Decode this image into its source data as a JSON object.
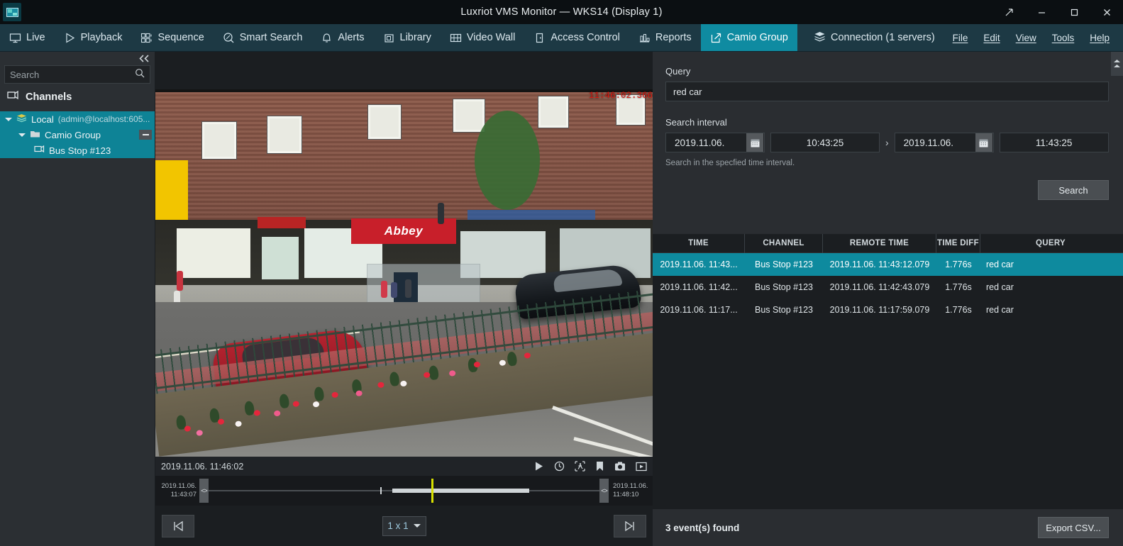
{
  "window": {
    "title": "Luxriot VMS Monitor — WKS14 (Display 1)",
    "app_icon": "monitor-icon",
    "restore_label": "⤢",
    "minimize_label": "–",
    "maximize_label": "▢",
    "close_label": "✕"
  },
  "tabs": [
    {
      "label": "Live",
      "icon": "monitor-icon",
      "active": false
    },
    {
      "label": "Playback",
      "icon": "play-triangle-icon",
      "active": false
    },
    {
      "label": "Sequence",
      "icon": "grid-sequence-icon",
      "active": false
    },
    {
      "label": "Smart Search",
      "icon": "magnifier-motion-icon",
      "active": false
    },
    {
      "label": "Alerts",
      "icon": "bell-icon",
      "active": false
    },
    {
      "label": "Library",
      "icon": "folder-archive-icon",
      "active": false
    },
    {
      "label": "Video Wall",
      "icon": "table-grid-icon",
      "active": false
    },
    {
      "label": "Access Control",
      "icon": "door-icon",
      "active": false
    },
    {
      "label": "Reports",
      "icon": "bar-chart-icon",
      "active": false
    },
    {
      "label": "Camio Group",
      "icon": "external-link-icon",
      "active": true
    }
  ],
  "connection": {
    "label": "Connection (1 servers)",
    "icon": "servers-stack-icon"
  },
  "menus": [
    {
      "label": "File"
    },
    {
      "label": "Edit"
    },
    {
      "label": "View"
    },
    {
      "label": "Tools"
    },
    {
      "label": "Help"
    }
  ],
  "sidebar": {
    "collapse_icon": "double-chevron-left-icon",
    "search": {
      "placeholder": "Search",
      "value": "",
      "icon": "search-icon"
    },
    "header": {
      "label": "Channels",
      "icon": "channels-icon"
    },
    "tree": [
      {
        "label": "Local",
        "sub": "(admin@localhost:605...",
        "level": 0,
        "selected": true,
        "expanded": true,
        "icon": "server-stack-icon"
      },
      {
        "label": "Camio Group",
        "sub": "",
        "level": 1,
        "selected": true,
        "expanded": true,
        "icon": "folder-icon",
        "has_minus": true
      },
      {
        "label": "Bus Stop #123",
        "sub": "",
        "level": 2,
        "selected": true,
        "expanded": false,
        "icon": "camera-channel-icon"
      }
    ]
  },
  "player": {
    "overlay_timestamp": "11:46:02.366",
    "current_time": "2019.11.06. 11:46:02",
    "toolbar_icons": [
      {
        "name": "play-icon"
      },
      {
        "name": "clock-icon"
      },
      {
        "name": "motion-search-icon"
      },
      {
        "name": "bookmark-icon"
      },
      {
        "name": "snapshot-camera-icon"
      },
      {
        "name": "export-video-icon"
      }
    ],
    "timeline": {
      "start_date": "2019.11.06.",
      "start_time": "11:43:07",
      "end_date": "2019.11.06.",
      "end_time": "11:48:10",
      "cursor_percent": 57,
      "recorded_start_percent": 47,
      "recorded_end_percent": 82,
      "tick_percent": 44
    },
    "prev_label": "◀|",
    "next_label": "|▶",
    "layout": {
      "value": "1 x 1"
    }
  },
  "search_panel": {
    "query_label": "Query",
    "query_value": "red car",
    "query_placeholder": "Query",
    "interval_label": "Search interval",
    "from_date": "2019.11.06.",
    "from_time": "10:43:25",
    "to_date": "2019.11.06.",
    "to_time": "11:43:25",
    "separator": "›",
    "calendar_icon": "calendar-icon",
    "hint": "Search in the specfied time interval.",
    "search_button": "Search"
  },
  "results": {
    "columns": [
      "TIME",
      "CHANNEL",
      "REMOTE TIME",
      "TIME DIFF",
      "QUERY"
    ],
    "rows": [
      {
        "time": "2019.11.06. 11:43...",
        "channel": "Bus Stop #123",
        "remote_time": "2019.11.06. 11:43:12.079",
        "time_diff": "1.776s",
        "query": "red car",
        "selected": true
      },
      {
        "time": "2019.11.06. 11:42...",
        "channel": "Bus Stop #123",
        "remote_time": "2019.11.06. 11:42:43.079",
        "time_diff": "1.776s",
        "query": "red car",
        "selected": false
      },
      {
        "time": "2019.11.06. 11:17...",
        "channel": "Bus Stop #123",
        "remote_time": "2019.11.06. 11:17:59.079",
        "time_diff": "1.776s",
        "query": "red car",
        "selected": false
      }
    ]
  },
  "status": {
    "found_text": "3 event(s) found",
    "export_button": "Export CSV..."
  },
  "colors": {
    "accent_teal": "#0f8ba1",
    "tabbar_blue": "#1d3944",
    "panel_dark": "#2a2d31",
    "table_dark": "#1b1e21",
    "timeline_cursor": "#d8e000",
    "overlay_red": "#e01a12"
  }
}
